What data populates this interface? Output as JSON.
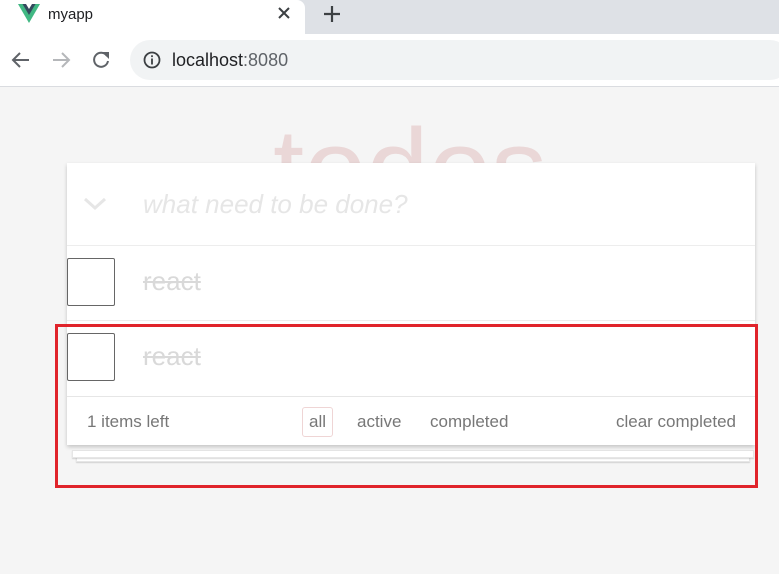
{
  "browser": {
    "tab": {
      "title": "myapp",
      "favicon": "vue-logo-icon"
    },
    "address": {
      "host": "localhost",
      "port": ":8080"
    }
  },
  "app": {
    "title": "todos",
    "input_placeholder": "what need to be done?",
    "todos": [
      {
        "label": "react",
        "completed": true
      },
      {
        "label": "react",
        "completed": true
      }
    ],
    "footer": {
      "count_text": "1 items left",
      "filters": [
        "all",
        "active",
        "completed"
      ],
      "selected_filter": "all",
      "clear_label": "clear completed"
    }
  },
  "colors": {
    "title": "#e9d7d7",
    "highlight_box": "#e0242b",
    "completed_text": "#d9d9d9"
  }
}
